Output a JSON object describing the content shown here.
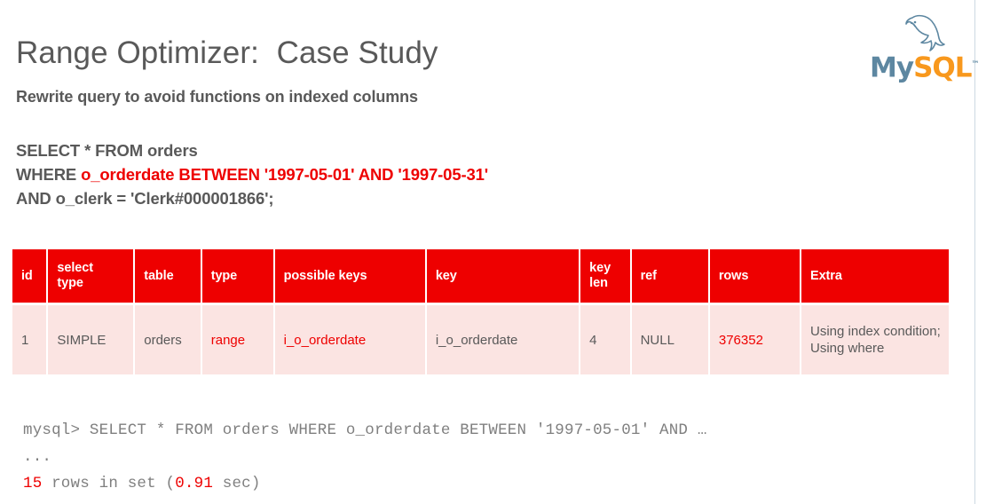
{
  "slide": {
    "title": "Range Optimizer:  Case Study",
    "subtitle": "Rewrite query to avoid functions on indexed columns"
  },
  "logo": {
    "name": "mysql-logo",
    "word_my": "My",
    "word_sql": "SQL",
    "trademark": "™",
    "color_my": "#5d87a1",
    "color_sql": "#f8981d"
  },
  "sql": {
    "line1": "SELECT * FROM orders",
    "line2_prefix": "WHERE ",
    "line2_highlight": "o_orderdate BETWEEN '1997-05-01' AND '1997-05-31'",
    "line3": "AND o_clerk = 'Clerk#000001866';",
    "highlight_color": "#ee0000"
  },
  "explain": {
    "headers": [
      "id",
      "select\ntype",
      "table",
      "type",
      "possible keys",
      "key",
      "key\nlen",
      "ref",
      "rows",
      "Extra"
    ],
    "header_bg": "#ee0000",
    "header_fg": "#ffffff",
    "row_bg": "#fbe4e2",
    "rows": [
      {
        "id": "1",
        "select_type": "SIMPLE",
        "table": "orders",
        "type": "range",
        "possible_keys": "i_o_orderdate",
        "key": "i_o_orderdate",
        "key_len": "4",
        "ref": "NULL",
        "rows": "376352",
        "extra": "Using index condition; Using where"
      }
    ]
  },
  "terminal": {
    "line1": "mysql> SELECT * FROM orders WHERE o_orderdate BETWEEN '1997-05-01' AND …",
    "line2": "...",
    "result_count": "15",
    "result_mid": " rows in set (",
    "result_time": "0.91",
    "result_suffix": " sec)",
    "text_color": "#7f7f7f",
    "accent_color": "#ee0000"
  }
}
